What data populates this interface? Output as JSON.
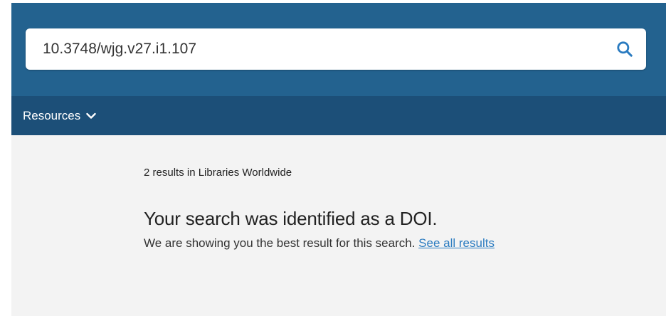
{
  "search": {
    "value": "10.3748/wjg.v27.i1.107",
    "icon": "search-icon"
  },
  "nav": {
    "resources_label": "Resources",
    "icon": "chevron-down-icon"
  },
  "results": {
    "count_text": "2 results in Libraries Worldwide",
    "doi_heading": "Your search was identified as a DOI.",
    "doi_message": "We are showing you the best result for this search.",
    "see_all_label": "See all results"
  },
  "colors": {
    "header_bg": "#23628f",
    "nav_bg": "#1c4f78",
    "content_bg": "#f3f3f3",
    "link": "#2a7bc0",
    "search_icon": "#2a7bc0"
  }
}
